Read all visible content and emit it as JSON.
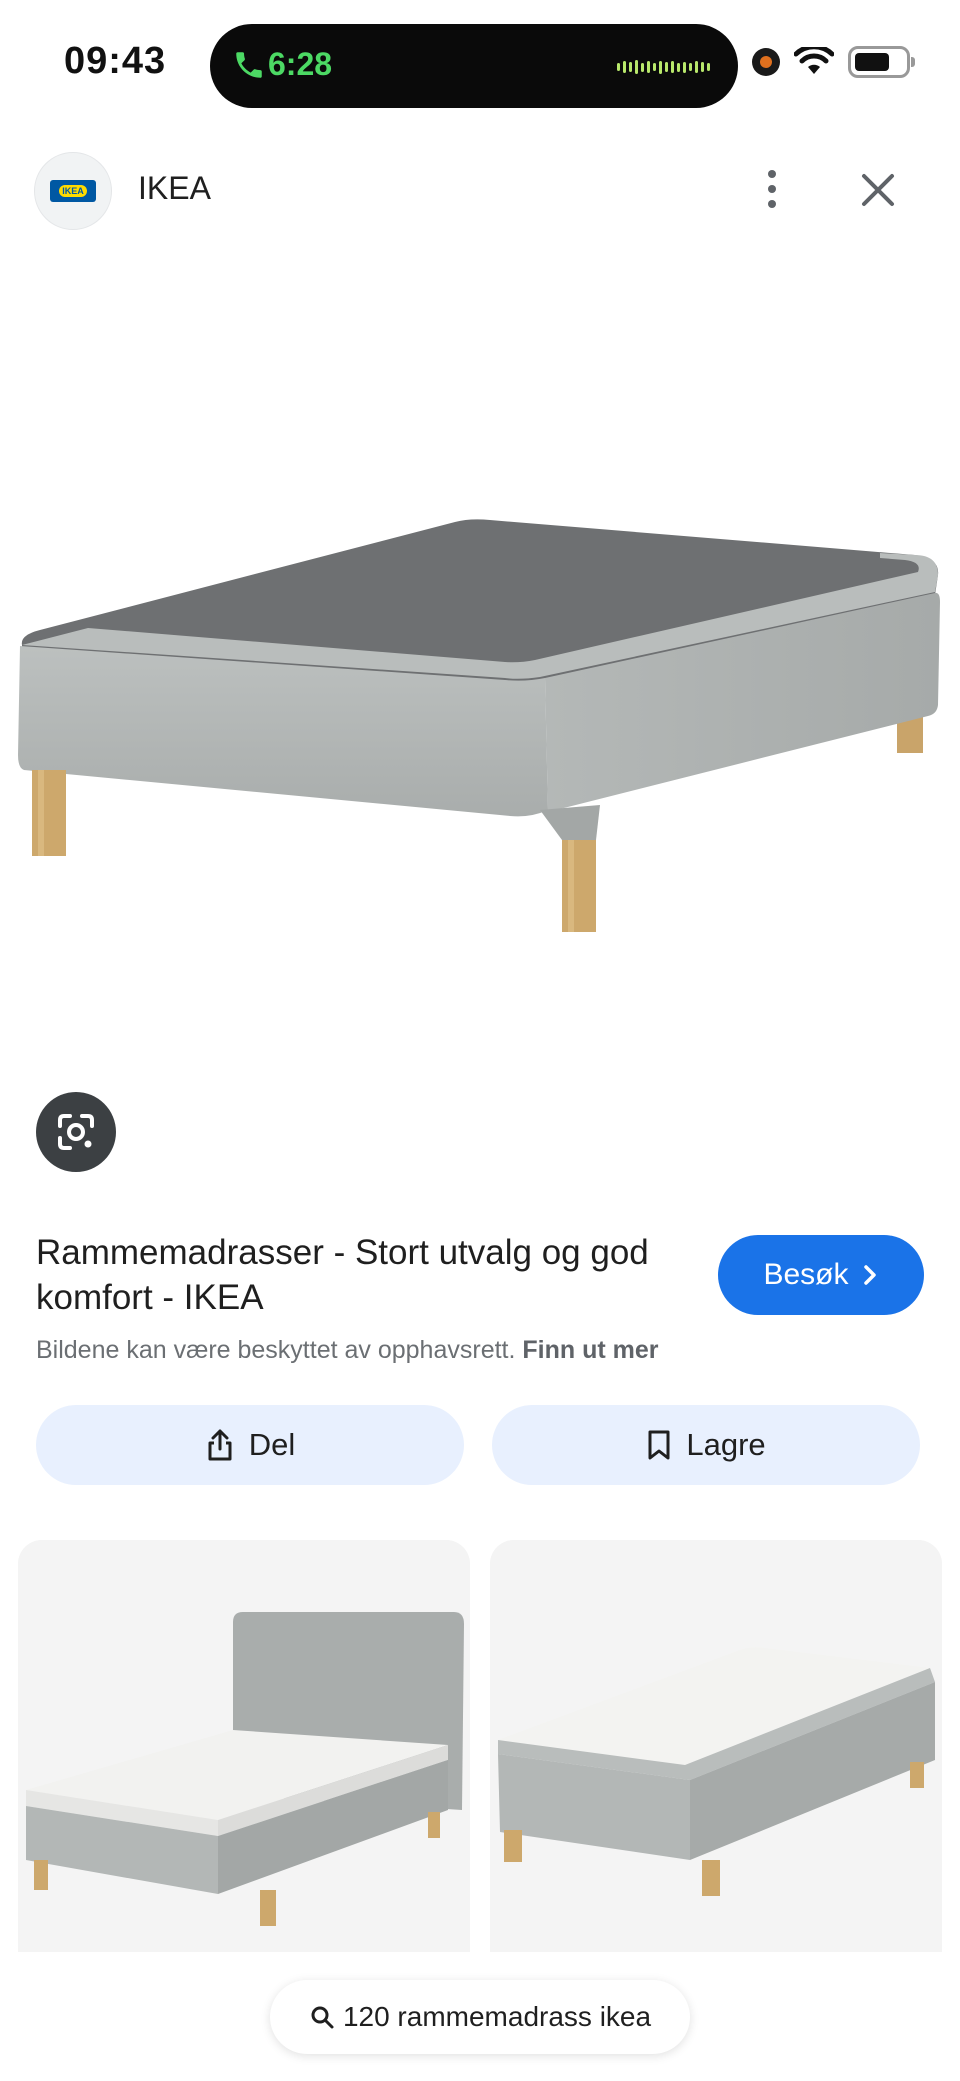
{
  "status_bar": {
    "time": "09:43",
    "call_duration": "6:28",
    "call_color": "#4cd964"
  },
  "header": {
    "site_name": "IKEA",
    "logo_text": "IKEA"
  },
  "result": {
    "title": "Rammemadrasser - Stort utvalg og god komfort - IKEA",
    "visit_label": "Besøk",
    "copyright_text": "Bildene kan være beskyttet av opphavsrett.",
    "learn_more": "Finn ut mer",
    "accent_color": "#1a73e8"
  },
  "actions": {
    "share_label": "Del",
    "save_label": "Lagre"
  },
  "related_search": {
    "label": "120 rammemadrass ikea"
  },
  "icons": [
    "phone-icon",
    "wifi-icon",
    "battery-icon",
    "more-vert-icon",
    "close-icon",
    "google-lens-icon",
    "chevron-right-icon",
    "share-icon",
    "bookmark-icon",
    "search-icon"
  ]
}
